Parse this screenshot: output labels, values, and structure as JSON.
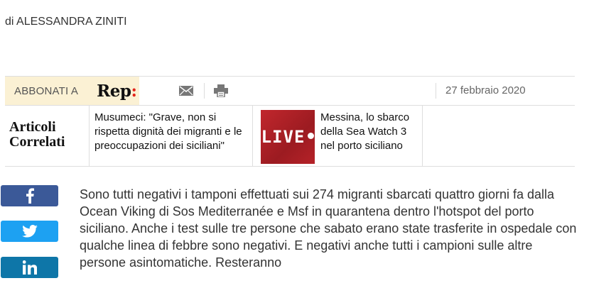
{
  "article": {
    "author": "di ALESSANDRA ZINITI",
    "date": "27 febbraio 2020",
    "body": "Sono tutti negativi i tamponi effettuati sui 274 migranti sbarcati quattro giorni fa dalla Ocean Viking di Sos Mediterranée e Msf in quarantena dentro l'hotspot del porto siciliano. Anche i test sulle tre persone che sabato erano state trasferite in ospedale con qualche linea di febbre sono negativi. E negativi anche tutti i campioni sulle altre persone asintomatiche. Resteranno"
  },
  "toolbar": {
    "subscribe_label": "ABBONATI A",
    "logo_text": "Rep",
    "logo_accent": ":",
    "icons": [
      "mail-icon",
      "print-icon"
    ]
  },
  "related": {
    "title_line1": "Articoli",
    "title_line2": "Correlati",
    "items": [
      {
        "text": "Musumeci: \"Grave, non si rispetta dignità dei migranti e le preoccupazioni dei siciliani\""
      },
      {
        "thumb_label": "LIVE",
        "text": "Messina, lo sbarco della Sea Watch 3 nel porto siciliano"
      }
    ]
  },
  "social": [
    "facebook-icon",
    "twitter-icon",
    "linkedin-icon"
  ],
  "colors": {
    "subscribe_bg": "#fbf1d4",
    "rep_accent": "#e2231a",
    "live_red": "#c1272d",
    "facebook": "#3b5998",
    "twitter": "#1da1f2",
    "linkedin": "#0e76a8"
  }
}
